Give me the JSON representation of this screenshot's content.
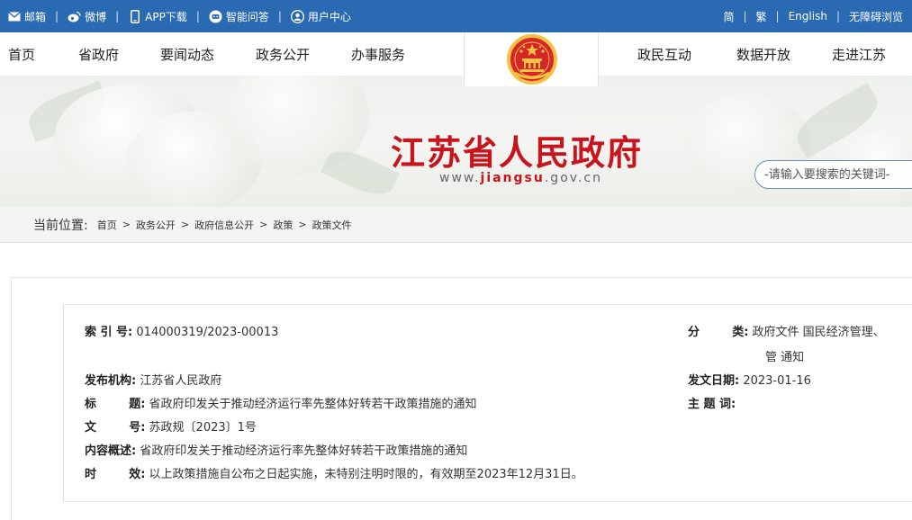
{
  "topbar": {
    "left": [
      {
        "icon": "mail-icon",
        "label": "邮箱"
      },
      {
        "icon": "weibo-icon",
        "label": "微博"
      },
      {
        "icon": "phone-icon",
        "label": "APP下载"
      },
      {
        "icon": "robot-icon",
        "label": "智能问答"
      },
      {
        "icon": "user-icon",
        "label": "用户中心"
      }
    ],
    "right": [
      "简",
      "繁",
      "English",
      "无障碍浏览"
    ]
  },
  "nav": {
    "items": [
      "首页",
      "省政府",
      "要闻动态",
      "政务公开",
      "办事服务",
      "政民互动",
      "数据开放",
      "走进江苏"
    ]
  },
  "banner": {
    "title": "江苏省人民政府",
    "url_prefix": "www.",
    "url_main": "jiangsu",
    "url_suffix": ".gov.cn",
    "search_placeholder": "-请输入要搜索的关键词-"
  },
  "breadcrumb": {
    "label": "当前位置:",
    "items": [
      "首页",
      "政务公开",
      "政府信息公开",
      "政策",
      "政策文件"
    ],
    "separator": ">"
  },
  "document": {
    "index_label": "索 引 号:",
    "index_value": "014000319/2023-00013",
    "category_label": "分      类:",
    "category_value": "政府文件 国民经济管理、",
    "category_value2": "管 通知",
    "issuer_label": "发布机构:",
    "issuer_value": "江苏省人民政府",
    "date_label": "发文日期:",
    "date_value": "2023-01-16",
    "title_label": "标      题:",
    "title_value": "省政府印发关于推动经济运行率先整体好转若干政策措施的通知",
    "subject_label": "主 题 词:",
    "subject_value": "",
    "docno_label": "文      号:",
    "docno_value": "苏政规〔2023〕1号",
    "summary_label": "内容概述:",
    "summary_value": "省政府印发关于推动经济运行率先整体好转若干政策措施的通知",
    "validity_label": "时      效:",
    "validity_value": "以上政策措施自公布之日起实施，未特别注明时限的，有效期至2023年12月31日。"
  },
  "colors": {
    "topbar": "#2a6ab3",
    "title_red": "#c8141c"
  }
}
